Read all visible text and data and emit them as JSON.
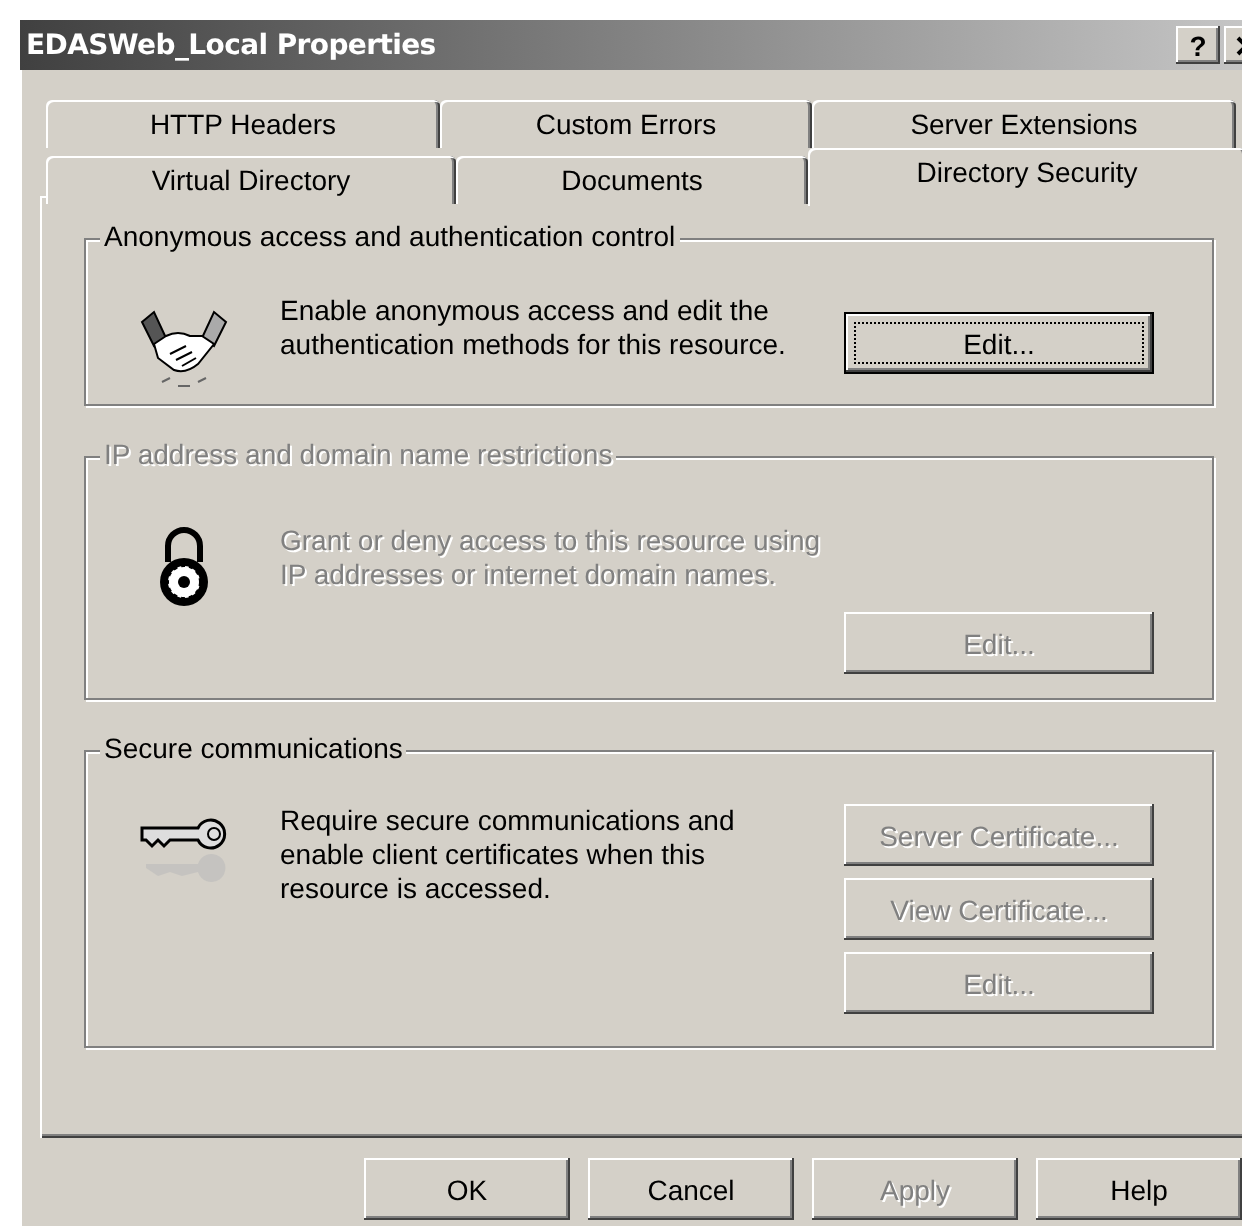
{
  "window": {
    "title": "EDASWeb_Local Properties",
    "help_button": "?"
  },
  "tab_rows": [
    [
      {
        "label": "HTTP Headers",
        "selected": false
      },
      {
        "label": "Custom Errors",
        "selected": false
      },
      {
        "label": "Server Extensions",
        "selected": false
      }
    ],
    [
      {
        "label": "Virtual Directory",
        "selected": false
      },
      {
        "label": "Documents",
        "selected": false
      },
      {
        "label": "Directory Security",
        "selected": true
      }
    ]
  ],
  "groups": [
    {
      "title": "Anonymous access and authentication control",
      "disabled": false,
      "lines": [
        "Enable anonymous access and edit the",
        "authentication methods for this resource."
      ],
      "buttons": [
        {
          "label": "Edit...",
          "disabled": false,
          "default": true
        }
      ]
    },
    {
      "title": "IP address and domain name restrictions",
      "disabled": true,
      "lines": [
        "Grant or deny access to this resource using",
        "IP addresses or internet domain names."
      ],
      "buttons": [
        {
          "label": "Edit...",
          "disabled": true,
          "default": false
        }
      ]
    },
    {
      "title": "Secure communications",
      "disabled": false,
      "lines": [
        "Require secure communications and",
        "enable client certificates when this",
        "resource is accessed."
      ],
      "buttons": [
        {
          "label": "Server Certificate...",
          "disabled": true,
          "default": false
        },
        {
          "label": "View Certificate...",
          "disabled": true,
          "default": false
        },
        {
          "label": "Edit...",
          "disabled": true,
          "default": false
        }
      ]
    }
  ],
  "buttons": [
    {
      "label": "OK",
      "disabled": false
    },
    {
      "label": "Cancel",
      "disabled": false
    },
    {
      "label": "Apply",
      "disabled": true
    },
    {
      "label": "Help",
      "disabled": false
    }
  ]
}
